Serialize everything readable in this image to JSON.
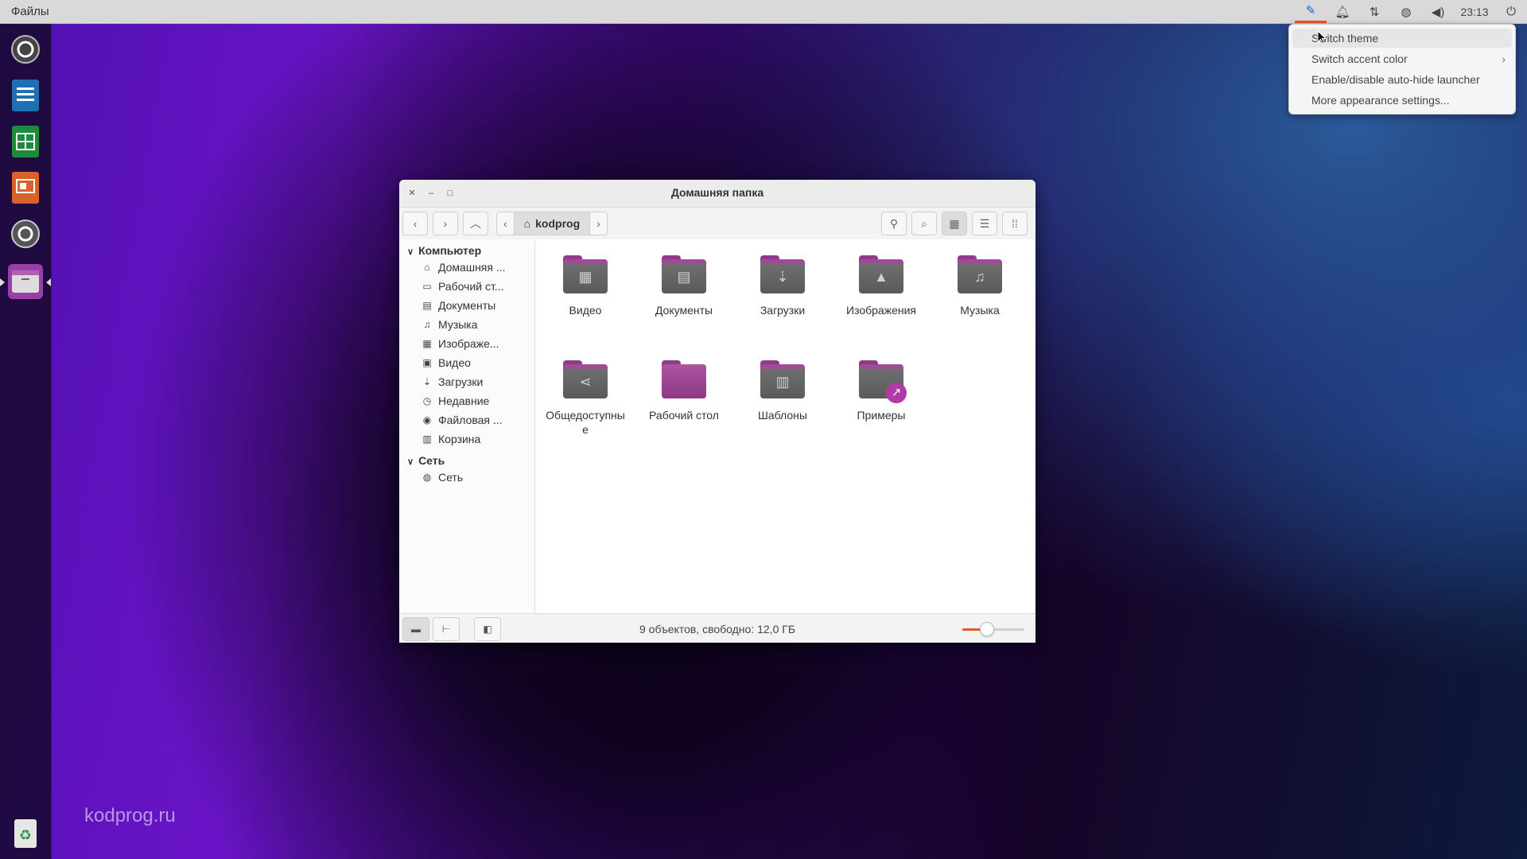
{
  "topbar": {
    "app_name": "Файлы",
    "clock": "23:13",
    "icons": [
      "appearance-brush-icon",
      "bell-icon",
      "network-icon",
      "globe-icon",
      "volume-icon",
      "power-icon"
    ]
  },
  "launcher": {
    "apps": [
      "updater-icon",
      "writer-icon",
      "calc-icon",
      "impress-icon",
      "settings-icon",
      "files-icon"
    ],
    "trash": "trash-icon"
  },
  "watermark": "kodprog.ru",
  "window": {
    "title": "Домашняя папка",
    "path": {
      "home": "kodprog"
    },
    "sidebar": {
      "computer_header": "Компьютер",
      "computer_items": [
        {
          "label": "Домашняя ...",
          "icon": "⌂"
        },
        {
          "label": "Рабочий ст...",
          "icon": "▭"
        },
        {
          "label": "Документы",
          "icon": "▤"
        },
        {
          "label": "Музыка",
          "icon": "♫"
        },
        {
          "label": "Изображе...",
          "icon": "▦"
        },
        {
          "label": "Видео",
          "icon": "▣"
        },
        {
          "label": "Загрузки",
          "icon": "⇣"
        },
        {
          "label": "Недавние",
          "icon": "◷"
        },
        {
          "label": "Файловая ...",
          "icon": "◉"
        },
        {
          "label": "Корзина",
          "icon": "▥"
        }
      ],
      "network_header": "Сеть",
      "network_items": [
        {
          "label": "Сеть",
          "icon": "◍"
        }
      ]
    },
    "folders": [
      {
        "label": "Видео",
        "glyph": "▦"
      },
      {
        "label": "Документы",
        "glyph": "▤"
      },
      {
        "label": "Загрузки",
        "glyph": "⇣"
      },
      {
        "label": "Изображения",
        "glyph": "▲"
      },
      {
        "label": "Музыка",
        "glyph": "♫"
      },
      {
        "label": "Общедоступны е",
        "glyph": "⋖"
      },
      {
        "label": "Рабочий стол",
        "glyph": ""
      },
      {
        "label": "Шаблоны",
        "glyph": "▥"
      },
      {
        "label": "Примеры",
        "glyph": ""
      }
    ],
    "status": "9 объектов, свободно: 12,0 ГБ",
    "zoom_level": 0.4
  },
  "menu": {
    "items": [
      {
        "label": "Switch theme"
      },
      {
        "label": "Switch accent color",
        "submenu": true
      },
      {
        "label": "Enable/disable auto-hide launcher"
      },
      {
        "label": "More appearance settings..."
      }
    ]
  }
}
